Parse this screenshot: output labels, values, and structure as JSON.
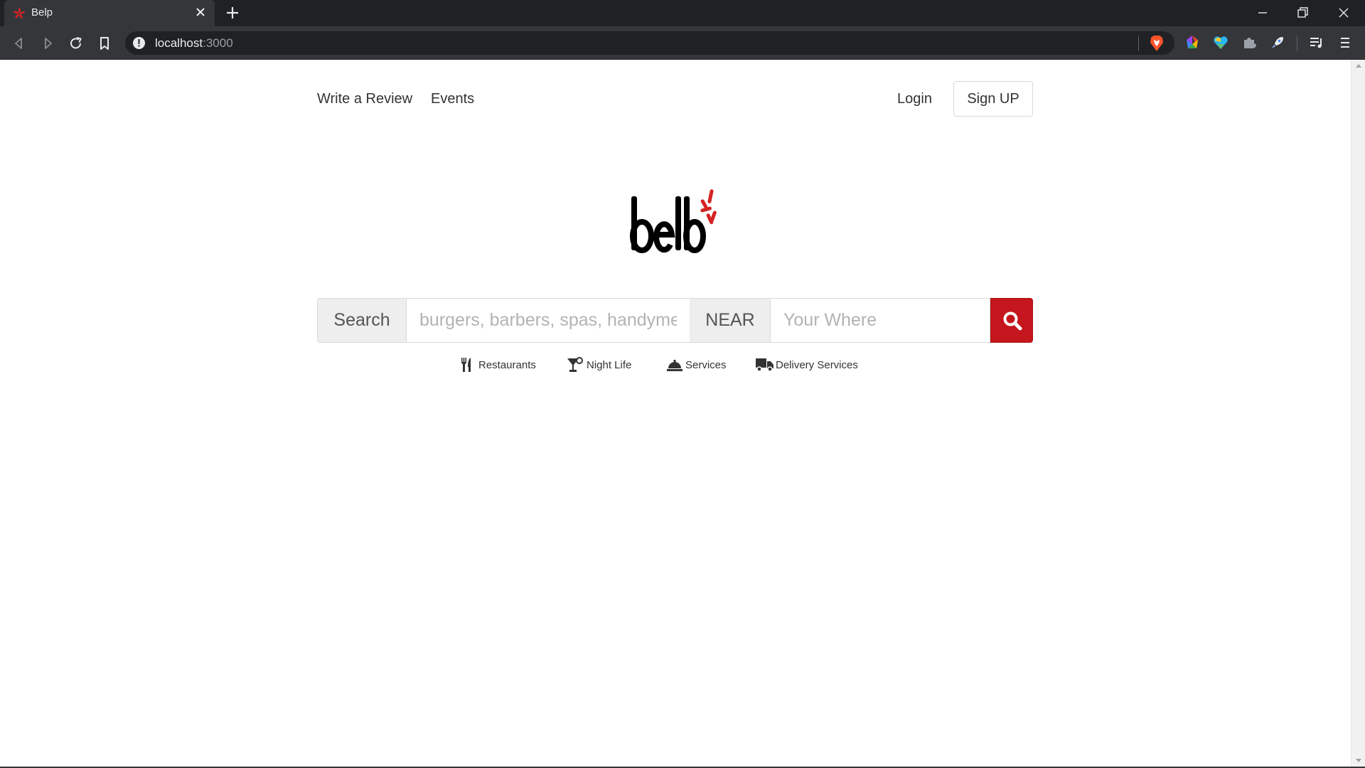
{
  "browser": {
    "tab_title": "Belp",
    "url_host": "localhost",
    "url_port": ":3000",
    "icons": [
      "yelp-burst-favicon",
      "close-tab-icon",
      "new-tab-icon",
      "minimize-icon",
      "restore-icon",
      "close-window-icon",
      "back-icon",
      "forward-icon",
      "reload-icon",
      "bookmark-icon",
      "info-icon",
      "brave-shield-icon",
      "extension-icons",
      "media-icon",
      "menu-icon"
    ]
  },
  "nav": {
    "write_review": "Write a Review",
    "events": "Events",
    "login": "Login",
    "signup": "Sign UP"
  },
  "search": {
    "search_label": "Search",
    "what_placeholder": "burgers, barbers, spas, handymen",
    "near_label": "NEAR",
    "where_placeholder": "Your Where"
  },
  "categories": [
    {
      "label": "Restaurants",
      "icon": "utensils-icon"
    },
    {
      "label": "Night Life",
      "icon": "cocktail-icon"
    },
    {
      "label": "Services",
      "icon": "service-bell-icon"
    },
    {
      "label": "Delivery Services",
      "icon": "truck-icon"
    }
  ],
  "colors": {
    "accent": "#c4161c",
    "chrome_dark": "#202124",
    "chrome_tab": "#35363a"
  }
}
